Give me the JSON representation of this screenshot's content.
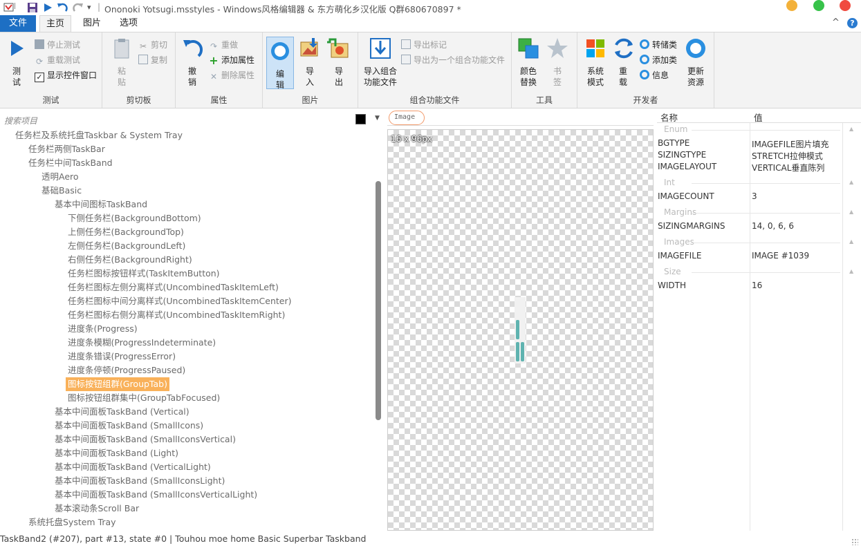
{
  "window": {
    "title": "Ononoki Yotsugi.msstyles - Windows风格编辑器 & 东方萌化乡汉化版 Q群680670897 *"
  },
  "ribbon_tabs": {
    "file": "文件",
    "home": "主页",
    "image": "图片",
    "options": "选项"
  },
  "ribbon": {
    "test_group": {
      "title": "测试",
      "test": "测\n试",
      "stop_test": "停止测试",
      "retest": "重载测试",
      "show_control_window": "显示控件窗口"
    },
    "clipboard_group": {
      "title": "剪切板",
      "paste": "粘\n贴",
      "cut": "剪切",
      "copy": "复制"
    },
    "property_group": {
      "title": "属性",
      "undo": "撤\n销",
      "redo": "重做",
      "add_property": "添加属性",
      "delete_property": "删除属性"
    },
    "image_group": {
      "title": "图片",
      "edit": "编\n辑",
      "import": "导\n入",
      "export": "导\n出"
    },
    "combo_group": {
      "title": "组合功能文件",
      "import_combo": "导入组合\n功能文件",
      "export_mark": "导出标记",
      "export_as_combo": "导出为一个组合功能文件"
    },
    "tools_group": {
      "title": "工具",
      "color_replace": "颜色\n替换",
      "bookmark": "书\n签"
    },
    "dev_group": {
      "title": "开发者",
      "system_mode": "系统\n模式",
      "reload": "重\n载",
      "storage_class": "转储类",
      "add_class": "添加类",
      "info": "信息",
      "update_resources": "更新\n资源"
    }
  },
  "left_pane": {
    "search_placeholder": "搜索项目",
    "tree": [
      {
        "label": "任务栏及系统托盘Taskbar & System Tray",
        "level": 1
      },
      {
        "label": "任务栏两侧TaskBar",
        "level": 2
      },
      {
        "label": "任务栏中间TaskBand",
        "level": 2
      },
      {
        "label": "透明Aero",
        "level": 3
      },
      {
        "label": "基础Basic",
        "level": 3
      },
      {
        "label": "基本中间图标TaskBand",
        "level": 4
      },
      {
        "label": "下侧任务栏(BackgroundBottom)",
        "level": 5
      },
      {
        "label": "上侧任务栏(BackgroundTop)",
        "level": 5
      },
      {
        "label": "左侧任务栏(BackgroundLeft)",
        "level": 5
      },
      {
        "label": "右侧任务栏(BackgroundRight)",
        "level": 5
      },
      {
        "label": "任务栏图标按钮样式(TaskItemButton)",
        "level": 5
      },
      {
        "label": "任务栏图标左侧分离样式(UncombinedTaskItemLeft)",
        "level": 5
      },
      {
        "label": "任务栏图标中间分离样式(UncombinedTaskItemCenter)",
        "level": 5
      },
      {
        "label": "任务栏图标右侧分离样式(UncombinedTaskItemRight)",
        "level": 5
      },
      {
        "label": "进度条(Progress)",
        "level": 5
      },
      {
        "label": "进度条模糊(ProgressIndeterminate)",
        "level": 5
      },
      {
        "label": "进度条错误(ProgressError)",
        "level": 5
      },
      {
        "label": "进度条停顿(ProgressPaused)",
        "level": 5
      },
      {
        "label": "图标按钮组群(GroupTab)",
        "level": 5,
        "selected": true
      },
      {
        "label": "图标按钮组群集中(GroupTabFocused)",
        "level": 5
      },
      {
        "label": "基本中间面板TaskBand (Vertical)",
        "level": 4
      },
      {
        "label": "基本中间面板TaskBand (SmallIcons)",
        "level": 4
      },
      {
        "label": "基本中间面板TaskBand (SmallIconsVertical)",
        "level": 4
      },
      {
        "label": "基本中间面板TaskBand (Light)",
        "level": 4
      },
      {
        "label": "基本中间面板TaskBand (VerticalLight)",
        "level": 4
      },
      {
        "label": "基本中间面板TaskBand (SmallIconsLight)",
        "level": 4
      },
      {
        "label": "基本中间面板TaskBand (SmallIconsVerticalLight)",
        "level": 4
      },
      {
        "label": "基本滚动条Scroll Bar",
        "level": 4
      },
      {
        "label": "系统托盘System Tray",
        "level": 2
      }
    ]
  },
  "preview": {
    "label": "Image",
    "dimensions": "16 x 96px",
    "accent_color": "#5fb3b0"
  },
  "properties": {
    "header_name": "名称",
    "header_value": "值",
    "categories": [
      {
        "name": "Enum",
        "rows": [
          {
            "name": "BGTYPE",
            "value": "IMAGEFILE图片填充"
          },
          {
            "name": "SIZINGTYPE",
            "value": "STRETCH拉伸模式"
          },
          {
            "name": "IMAGELAYOUT",
            "value": "VERTICAL垂直陈列"
          }
        ]
      },
      {
        "name": "Int",
        "rows": [
          {
            "name": "IMAGECOUNT",
            "value": "3"
          }
        ]
      },
      {
        "name": "Margins",
        "rows": [
          {
            "name": "SIZINGMARGINS",
            "value": "14, 0, 6, 6"
          }
        ]
      },
      {
        "name": "Images",
        "rows": [
          {
            "name": "IMAGEFILE",
            "value": "IMAGE #1039"
          }
        ]
      },
      {
        "name": "Size",
        "rows": [
          {
            "name": "WIDTH",
            "value": "16"
          }
        ]
      }
    ]
  },
  "status": {
    "text": "TaskBand2 (#207),  part #13,  state #0  |  Touhou moe home Basic Superbar Taskband"
  }
}
